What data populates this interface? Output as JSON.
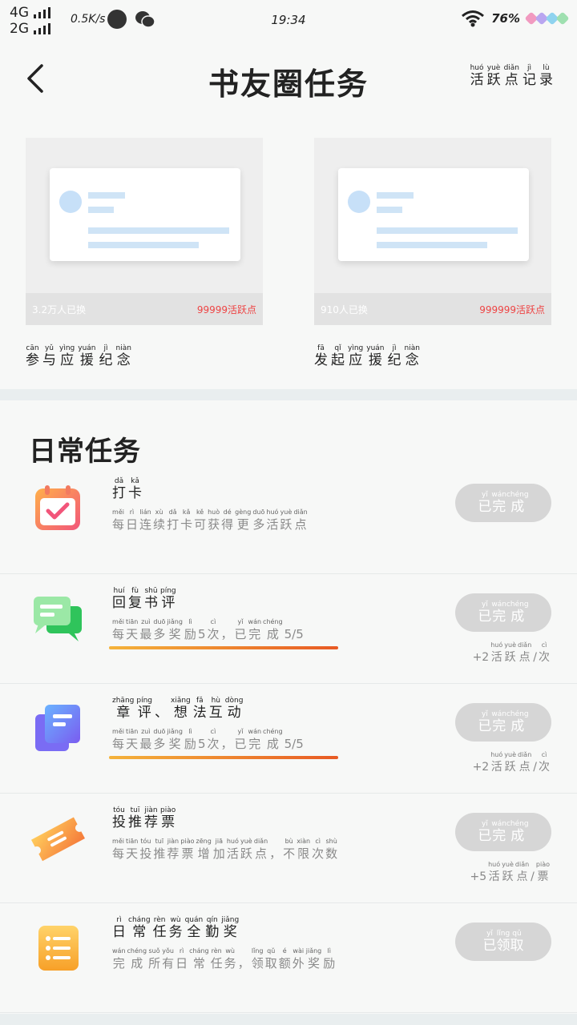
{
  "status": {
    "net1": "4G",
    "net2": "2G",
    "speed": "0.5K/s",
    "time": "19:34",
    "battery": "76%"
  },
  "header": {
    "title": "书友圈任务",
    "link": [
      {
        "p": "huó",
        "h": "活"
      },
      {
        "p": "yuè",
        "h": "跃"
      },
      {
        "p": "diǎn",
        "h": "点"
      },
      {
        "p": "jì",
        "h": "记"
      },
      {
        "p": "lù",
        "h": "录"
      }
    ]
  },
  "cards": [
    {
      "footer_left": "3.2万人已换",
      "footer_right": "99999活跃点",
      "caption": [
        {
          "p": "cān",
          "h": "参"
        },
        {
          "p": "yǔ",
          "h": "与"
        },
        {
          "p": "yìng",
          "h": "应"
        },
        {
          "p": "yuán",
          "h": "援"
        },
        {
          "p": "jì",
          "h": "纪"
        },
        {
          "p": "niàn",
          "h": "念"
        }
      ]
    },
    {
      "footer_left": "910人已换",
      "footer_right": "999999活跃点",
      "caption": [
        {
          "p": "fā",
          "h": "发"
        },
        {
          "p": "qǐ",
          "h": "起"
        },
        {
          "p": "yìng",
          "h": "应"
        },
        {
          "p": "yuán",
          "h": "援"
        },
        {
          "p": "jì",
          "h": "纪"
        },
        {
          "p": "niàn",
          "h": "念"
        }
      ]
    }
  ],
  "daily": {
    "title": "日常任务",
    "tasks": [
      {
        "icon": "calendar-check-icon",
        "name": [
          {
            "p": "dǎ",
            "h": "打"
          },
          {
            "p": "kǎ",
            "h": "卡"
          }
        ],
        "desc": [
          {
            "p": "měi",
            "h": "每"
          },
          {
            "p": "rì",
            "h": "日"
          },
          {
            "p": "lián",
            "h": "连"
          },
          {
            "p": "xù",
            "h": "续"
          },
          {
            "p": "dǎ",
            "h": "打"
          },
          {
            "p": "kǎ",
            "h": "卡"
          },
          {
            "p": "kě",
            "h": "可"
          },
          {
            "p": "huò",
            "h": "获"
          },
          {
            "p": "dé",
            "h": "得"
          },
          {
            "p": "gèng",
            "h": "更"
          },
          {
            "p": "duō",
            "h": "多"
          },
          {
            "p": "huó",
            "h": "活"
          },
          {
            "p": "yuè",
            "h": "跃"
          },
          {
            "p": "diǎn",
            "h": "点"
          }
        ],
        "button": [
          {
            "p": "yǐ",
            "h": "已"
          },
          {
            "p": "wán",
            "h": "完"
          },
          {
            "p": "chéng",
            "h": "成"
          }
        ],
        "extra": null,
        "progress": null
      },
      {
        "icon": "chat-bubble-icon",
        "name": [
          {
            "p": "huí",
            "h": "回"
          },
          {
            "p": "fù",
            "h": "复"
          },
          {
            "p": "shū",
            "h": "书"
          },
          {
            "p": "píng",
            "h": "评"
          }
        ],
        "desc": [
          {
            "p": "měi",
            "h": "每"
          },
          {
            "p": "tiān",
            "h": "天"
          },
          {
            "p": "zuì",
            "h": "最"
          },
          {
            "p": "duō",
            "h": "多"
          },
          {
            "p": "jiǎng",
            "h": "奖"
          },
          {
            "p": "lì",
            "h": "励"
          },
          {
            "p": "",
            "h": "5"
          },
          {
            "p": "cì",
            "h": "次"
          },
          {
            "p": "",
            "h": "，"
          },
          {
            "p": "yǐ",
            "h": "已"
          },
          {
            "p": "wán",
            "h": "完"
          },
          {
            "p": "chéng",
            "h": "成"
          },
          {
            "p": "",
            "h": "5/5"
          }
        ],
        "button": [
          {
            "p": "yǐ",
            "h": "已"
          },
          {
            "p": "wán",
            "h": "完"
          },
          {
            "p": "chéng",
            "h": "成"
          }
        ],
        "extra": [
          {
            "p": "",
            "h": "+2"
          },
          {
            "p": "huó",
            "h": "活"
          },
          {
            "p": "yuè",
            "h": "跃"
          },
          {
            "p": "diǎn",
            "h": "点"
          },
          {
            "p": "",
            "h": "/"
          },
          {
            "p": "cì",
            "h": "次"
          }
        ],
        "progress": 1.0
      },
      {
        "icon": "document-stack-icon",
        "name": [
          {
            "p": "zhāng",
            "h": "章"
          },
          {
            "p": "píng",
            "h": "评"
          },
          {
            "p": "",
            "h": "、"
          },
          {
            "p": "xiǎng",
            "h": "想"
          },
          {
            "p": "fǎ",
            "h": "法"
          },
          {
            "p": "hù",
            "h": "互"
          },
          {
            "p": "dòng",
            "h": "动"
          }
        ],
        "desc": [
          {
            "p": "měi",
            "h": "每"
          },
          {
            "p": "tiān",
            "h": "天"
          },
          {
            "p": "zuì",
            "h": "最"
          },
          {
            "p": "duō",
            "h": "多"
          },
          {
            "p": "jiǎng",
            "h": "奖"
          },
          {
            "p": "lì",
            "h": "励"
          },
          {
            "p": "",
            "h": "5"
          },
          {
            "p": "cì",
            "h": "次"
          },
          {
            "p": "",
            "h": "，"
          },
          {
            "p": "yǐ",
            "h": "已"
          },
          {
            "p": "wán",
            "h": "完"
          },
          {
            "p": "chéng",
            "h": "成"
          },
          {
            "p": "",
            "h": "5/5"
          }
        ],
        "button": [
          {
            "p": "yǐ",
            "h": "已"
          },
          {
            "p": "wán",
            "h": "完"
          },
          {
            "p": "chéng",
            "h": "成"
          }
        ],
        "extra": [
          {
            "p": "",
            "h": "+2"
          },
          {
            "p": "huó",
            "h": "活"
          },
          {
            "p": "yuè",
            "h": "跃"
          },
          {
            "p": "diǎn",
            "h": "点"
          },
          {
            "p": "",
            "h": "/"
          },
          {
            "p": "cì",
            "h": "次"
          }
        ],
        "progress": 1.0
      },
      {
        "icon": "ticket-icon",
        "name": [
          {
            "p": "tóu",
            "h": "投"
          },
          {
            "p": "tuī",
            "h": "推"
          },
          {
            "p": "jiàn",
            "h": "荐"
          },
          {
            "p": "piào",
            "h": "票"
          }
        ],
        "desc": [
          {
            "p": "měi",
            "h": "每"
          },
          {
            "p": "tiān",
            "h": "天"
          },
          {
            "p": "tóu",
            "h": "投"
          },
          {
            "p": "tuī",
            "h": "推"
          },
          {
            "p": "jiàn",
            "h": "荐"
          },
          {
            "p": "piào",
            "h": "票"
          },
          {
            "p": "zēng",
            "h": "增"
          },
          {
            "p": "jiā",
            "h": "加"
          },
          {
            "p": "huó",
            "h": "活"
          },
          {
            "p": "yuè",
            "h": "跃"
          },
          {
            "p": "diǎn",
            "h": "点"
          },
          {
            "p": "",
            "h": "，"
          },
          {
            "p": "bù",
            "h": "不"
          },
          {
            "p": "xiàn",
            "h": "限"
          },
          {
            "p": "cì",
            "h": "次"
          },
          {
            "p": "shù",
            "h": "数"
          }
        ],
        "button": [
          {
            "p": "yǐ",
            "h": "已"
          },
          {
            "p": "wán",
            "h": "完"
          },
          {
            "p": "chéng",
            "h": "成"
          }
        ],
        "extra": [
          {
            "p": "",
            "h": "+5"
          },
          {
            "p": "huó",
            "h": "活"
          },
          {
            "p": "yuè",
            "h": "跃"
          },
          {
            "p": "diǎn",
            "h": "点"
          },
          {
            "p": "",
            "h": "/"
          },
          {
            "p": "piào",
            "h": "票"
          }
        ],
        "progress": null
      },
      {
        "icon": "list-icon",
        "name": [
          {
            "p": "rì",
            "h": "日"
          },
          {
            "p": "cháng",
            "h": "常"
          },
          {
            "p": "rèn",
            "h": "任"
          },
          {
            "p": "wù",
            "h": "务"
          },
          {
            "p": "quán",
            "h": "全"
          },
          {
            "p": "qín",
            "h": "勤"
          },
          {
            "p": "jiǎng",
            "h": "奖"
          }
        ],
        "desc": [
          {
            "p": "wán",
            "h": "完"
          },
          {
            "p": "chéng",
            "h": "成"
          },
          {
            "p": "suǒ",
            "h": "所"
          },
          {
            "p": "yǒu",
            "h": "有"
          },
          {
            "p": "rì",
            "h": "日"
          },
          {
            "p": "cháng",
            "h": "常"
          },
          {
            "p": "rèn",
            "h": "任"
          },
          {
            "p": "wù",
            "h": "务"
          },
          {
            "p": "",
            "h": "，"
          },
          {
            "p": "lǐng",
            "h": "领"
          },
          {
            "p": "qǔ",
            "h": "取"
          },
          {
            "p": "é",
            "h": "额"
          },
          {
            "p": "wài",
            "h": "外"
          },
          {
            "p": "jiǎng",
            "h": "奖"
          },
          {
            "p": "lì",
            "h": "励"
          }
        ],
        "button": [
          {
            "p": "yǐ",
            "h": "已"
          },
          {
            "p": "lǐng",
            "h": "领"
          },
          {
            "p": "qǔ",
            "h": "取"
          }
        ],
        "extra": null,
        "progress": null
      }
    ]
  }
}
